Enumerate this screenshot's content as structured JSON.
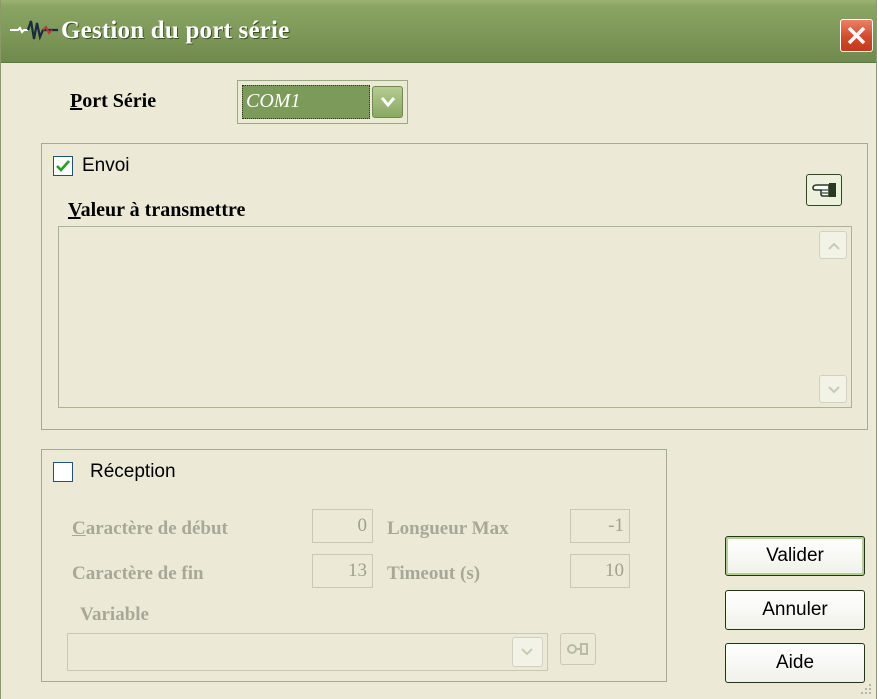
{
  "window": {
    "title": "Gestion du port série",
    "close_icon": "close-icon"
  },
  "port": {
    "label_accel": "P",
    "label_rest": "ort Série",
    "selected": "COM1"
  },
  "envoi": {
    "checkbox_label": "Envoi",
    "checked": true,
    "value_label_accel": "V",
    "value_label_rest": "aleur à transmettre",
    "value_text": "",
    "send_icon": "pointing-hand-icon"
  },
  "reception": {
    "checkbox_label": "Réception",
    "checked": false,
    "start_char_label_accel": "C",
    "start_char_label_rest": "aractère de début",
    "start_char_value": "0",
    "end_char_label": "Caractère de fin",
    "end_char_value": "13",
    "max_length_label": "Longueur Max",
    "max_length_value": "-1",
    "timeout_label": "Timeout (s)",
    "timeout_value": "10",
    "variable_label": "Variable",
    "variable_value": ""
  },
  "buttons": {
    "ok": "Valider",
    "cancel": "Annuler",
    "help": "Aide"
  },
  "colors": {
    "titlebar": "#7d9858",
    "window_bg": "#ecead7",
    "close_button": "#d4492a"
  }
}
